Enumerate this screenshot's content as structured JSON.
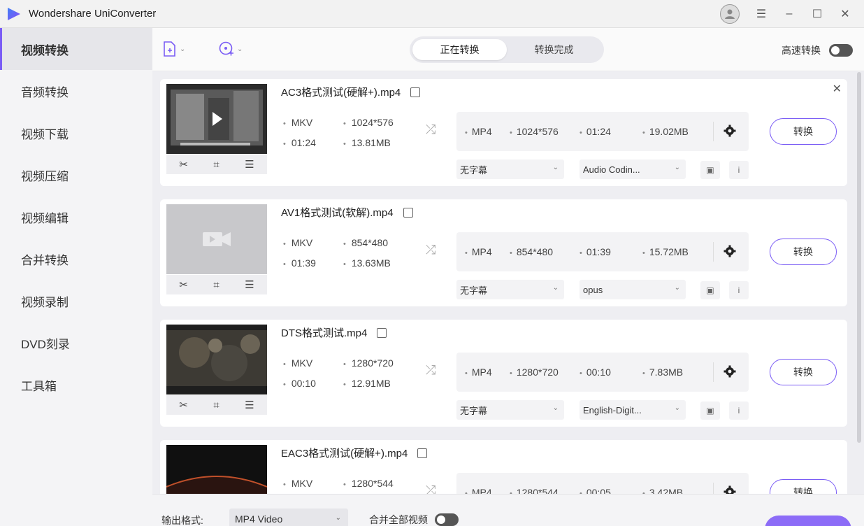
{
  "app": {
    "title": "Wondershare UniConverter"
  },
  "window": {
    "menu_icon": "☰",
    "minimize": "–",
    "maximize": "☐",
    "close": "✕"
  },
  "sidebar": {
    "items": [
      {
        "label": "视频转换",
        "active": true
      },
      {
        "label": "音频转换"
      },
      {
        "label": "视频下载"
      },
      {
        "label": "视频压缩"
      },
      {
        "label": "视频编辑"
      },
      {
        "label": "合并转换"
      },
      {
        "label": "视频录制"
      },
      {
        "label": "DVD刻录"
      },
      {
        "label": "工具箱"
      }
    ]
  },
  "toolbar": {
    "tabs": [
      "正在转换",
      "转换完成"
    ],
    "speed_label": "高速转换"
  },
  "files": [
    {
      "name": "AC3格式测试(硬解+).mp4",
      "src_format": "MKV",
      "src_res": "1024*576",
      "src_dur": "01:24",
      "src_size": "13.81MB",
      "out_format": "MP4",
      "out_res": "1024*576",
      "out_dur": "01:24",
      "out_size": "19.02MB",
      "subtitle": "无字幕",
      "audio": "Audio Codin...",
      "convert": "转换",
      "info": "i"
    },
    {
      "name": "AV1格式测试(软解).mp4",
      "src_format": "MKV",
      "src_res": "854*480",
      "src_dur": "01:39",
      "src_size": "13.63MB",
      "out_format": "MP4",
      "out_res": "854*480",
      "out_dur": "01:39",
      "out_size": "15.72MB",
      "subtitle": "无字幕",
      "audio": "opus",
      "convert": "转换",
      "info": "i"
    },
    {
      "name": "DTS格式测试.mp4",
      "src_format": "MKV",
      "src_res": "1280*720",
      "src_dur": "00:10",
      "src_size": "12.91MB",
      "out_format": "MP4",
      "out_res": "1280*720",
      "out_dur": "00:10",
      "out_size": "7.83MB",
      "subtitle": "无字幕",
      "audio": "English-Digit...",
      "convert": "转换",
      "info": "i"
    },
    {
      "name": "EAC3格式测试(硬解+).mp4",
      "src_format": "MKV",
      "src_res": "1280*544",
      "out_format": "MP4",
      "out_res": "1280*544",
      "out_dur": "00:05",
      "out_size": "3.42MB",
      "convert": "转换"
    }
  ],
  "footer": {
    "format_label": "输出格式:",
    "format_value": "MP4 Video",
    "merge_label": "合并全部视频"
  },
  "colors": {
    "accent": "#7a5cf5"
  }
}
